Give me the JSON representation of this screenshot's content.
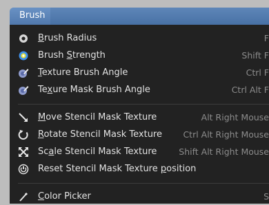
{
  "menu": {
    "title": "Brush",
    "groups": [
      [
        {
          "pre": "",
          "u": "B",
          "post": "rush Radius",
          "shortcut": "F",
          "icon": "circle-dot-icon"
        },
        {
          "pre": "Brush ",
          "u": "S",
          "post": "trength",
          "shortcut": "Shift F",
          "icon": "brush-strength-icon"
        },
        {
          "pre": "",
          "u": "T",
          "post": "exture Brush Angle",
          "shortcut": "Ctrl F",
          "icon": "texture-brush-icon"
        },
        {
          "pre": "Te",
          "u": "x",
          "post": "ure Mask Brush Angle",
          "shortcut": "Ctrl Alt F",
          "icon": "texture-mask-icon"
        }
      ],
      [
        {
          "pre": "",
          "u": "M",
          "post": "ove Stencil Mask Texture",
          "shortcut": "Alt Right Mouse",
          "icon": "move-arrow-icon"
        },
        {
          "pre": "",
          "u": "R",
          "post": "otate Stencil Mask Texture",
          "shortcut": "Ctrl Alt Right Mouse",
          "icon": "rotate-icon"
        },
        {
          "pre": "Sc",
          "u": "a",
          "post": "le Stencil Mask Texture",
          "shortcut": "Shift Alt Right Mouse",
          "icon": "scale-icon"
        },
        {
          "pre": "Reset Stencil Mask Texture ",
          "u": "p",
          "post": "osition",
          "shortcut": "",
          "icon": "reset-power-icon"
        }
      ],
      [
        {
          "pre": "",
          "u": "C",
          "post": "olor Picker",
          "shortcut": "S",
          "icon": "eyedropper-icon"
        }
      ]
    ]
  }
}
